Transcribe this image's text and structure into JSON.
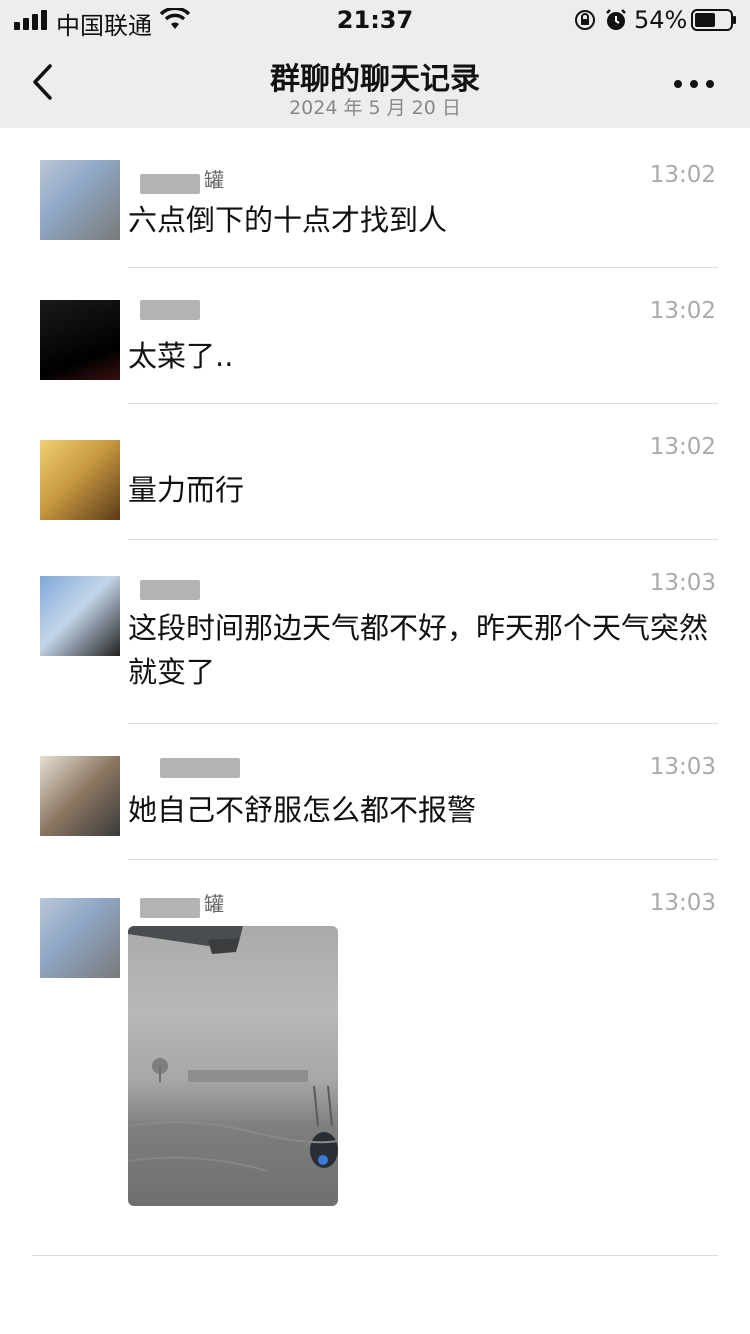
{
  "status_bar": {
    "carrier": "中国联通",
    "time": "21:37",
    "battery": "54%"
  },
  "nav": {
    "title": "群聊的聊天记录",
    "date": "2024 年 5 月 20 日",
    "icons": [
      "chevron-left-icon",
      "more-icon"
    ]
  },
  "messages": [
    {
      "name_suffix": "罐",
      "time": "13:02",
      "text": "六点倒下的十点才找到人"
    },
    {
      "name_suffix": "",
      "time": "13:02",
      "text": "太菜了.."
    },
    {
      "name_suffix": "",
      "time": "13:02",
      "text": "量力而行"
    },
    {
      "name_suffix": "",
      "time": "13:03",
      "text": "这段时间那边天气都不好，昨天那个天气突然就变了"
    },
    {
      "name_suffix": "",
      "time": "13:03",
      "text": "她自己不舒服怎么都不报警"
    },
    {
      "name_suffix": "罐",
      "time": "13:03",
      "text": ""
    }
  ]
}
